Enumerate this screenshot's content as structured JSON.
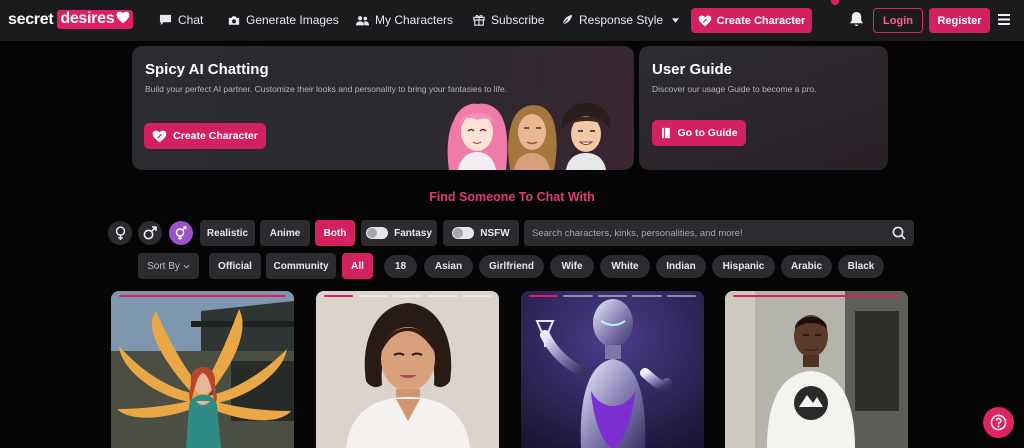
{
  "brand": {
    "part1": "secret",
    "part2": "desires",
    "accent": "#e01e62"
  },
  "nav": {
    "items": [
      {
        "label": "Chat",
        "icon": "chat-icon"
      },
      {
        "label": "Generate Images",
        "icon": "camera-icon"
      },
      {
        "label": "My Characters",
        "icon": "users-icon"
      },
      {
        "label": "Subscribe",
        "icon": "gift-icon"
      },
      {
        "label": "Response Style",
        "icon": "feather-icon"
      }
    ],
    "create_label": "Create Character",
    "login_label": "Login",
    "register_label": "Register"
  },
  "hero": {
    "title": "Spicy AI Chatting",
    "subtitle": "Build your perfect AI partner. Customize their looks and personality to bring your fantasies to life.",
    "button": "Create Character"
  },
  "guide": {
    "title": "User Guide",
    "subtitle": "Discover our usage Guide to become a pro.",
    "button": "Go to Guide"
  },
  "section_title": "Find Someone To Chat With",
  "filters": {
    "gender": [
      {
        "icon": "female-icon",
        "active": false
      },
      {
        "icon": "male-icon",
        "active": false
      },
      {
        "icon": "gender-both-icon",
        "active": true
      }
    ],
    "styles": [
      {
        "label": "Realistic",
        "selected": false
      },
      {
        "label": "Anime",
        "selected": false
      },
      {
        "label": "Both",
        "selected": true
      }
    ],
    "toggles": [
      {
        "label": "Fantasy",
        "on": false
      },
      {
        "label": "NSFW",
        "on": false
      }
    ],
    "search_placeholder": "Search characters, kinks, personalities, and more!",
    "sort_label": "Sort By",
    "source": [
      {
        "label": "Official",
        "selected": false
      },
      {
        "label": "Community",
        "selected": false
      }
    ],
    "tags": [
      "All",
      "18",
      "Asian",
      "Girlfriend",
      "Wife",
      "White",
      "Indian",
      "Hispanic",
      "Arabic",
      "Black"
    ],
    "selected_tag": "All"
  },
  "characters": [
    {
      "subject": "nine-tailed-fox-woman"
    },
    {
      "subject": "bob-haired-woman"
    },
    {
      "subject": "chrome-robot"
    },
    {
      "subject": "man-white-tshirt"
    }
  ]
}
